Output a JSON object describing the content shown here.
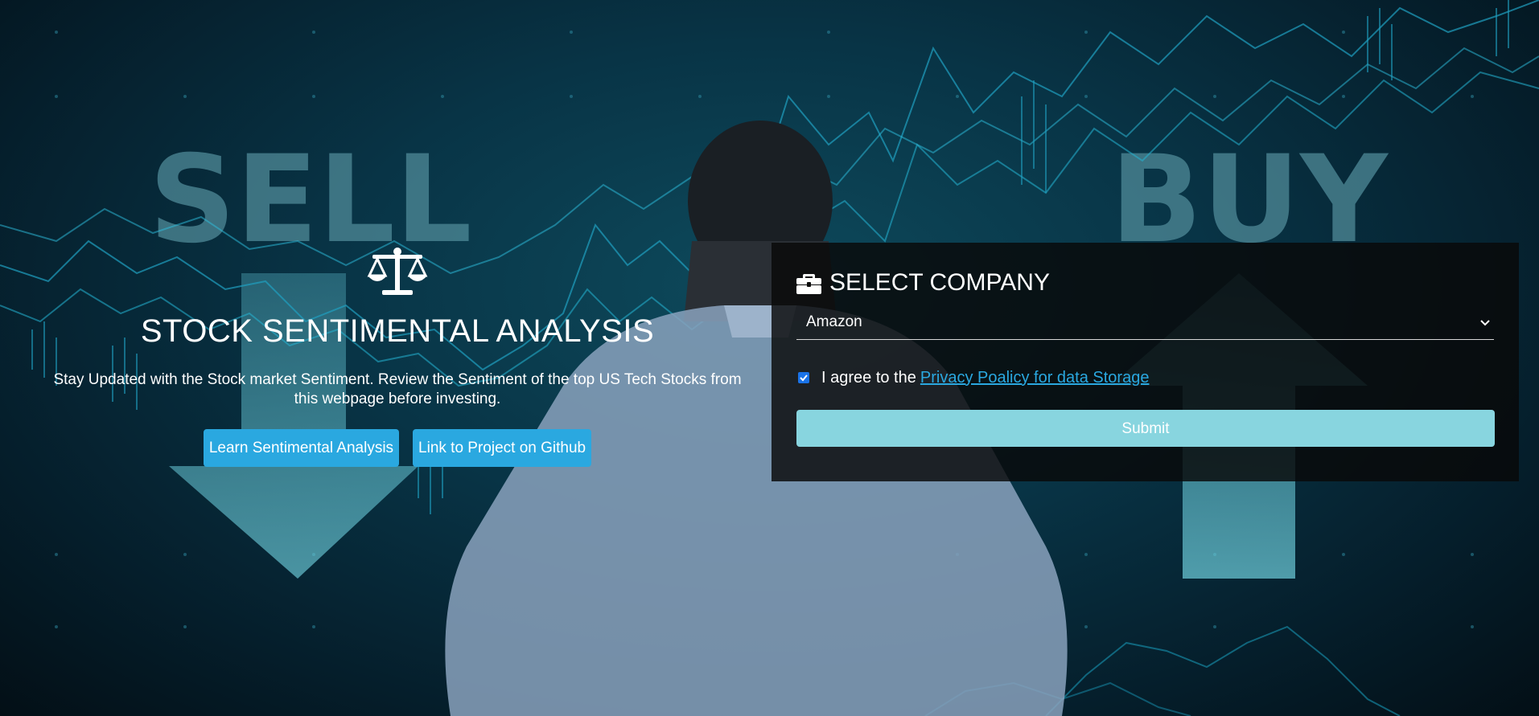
{
  "background": {
    "sell_word": "SELL",
    "buy_word": "BUY"
  },
  "hero": {
    "icon": "balance-scale-icon",
    "title": "STOCK SENTIMENTAL ANALYSIS",
    "description": "Stay Updated with the Stock market Sentiment. Review the Sentiment of the top US Tech Stocks from this webpage before investing.",
    "buttons": {
      "learn_label": "Learn Sentimental Analysis",
      "github_label": "Link to Project on Github"
    }
  },
  "form": {
    "icon": "briefcase-icon",
    "title": "SELECT COMPANY",
    "select": {
      "selected_value": "Amazon"
    },
    "agree": {
      "checked": true,
      "text": "I agree to the",
      "link_text": "Privacy Poalicy for data Storage"
    },
    "submit_label": "Submit"
  },
  "colors": {
    "accent_button": "#2aa8e0",
    "submit_button": "#88d5df",
    "link": "#2aa8e0",
    "panel_bg": "#080808"
  }
}
